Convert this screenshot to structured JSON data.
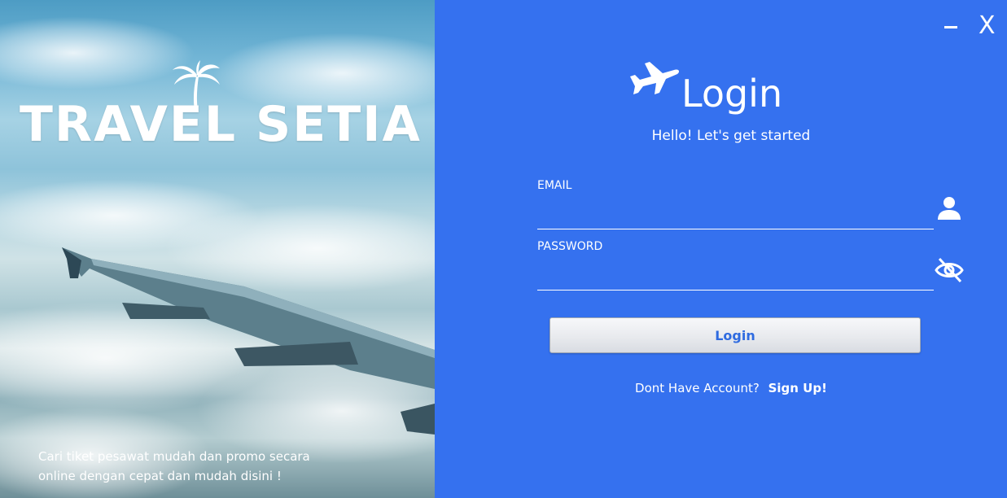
{
  "brand": {
    "title": "TRAVEL SETIA",
    "tagline_line1": "Cari tiket pesawat mudah dan  promo secara",
    "tagline_line2": "online dengan cepat dan mudah disini !"
  },
  "window": {
    "minimize_label": "",
    "close_label": "X"
  },
  "login": {
    "title": "Login",
    "subtitle": "Hello! Let's get started",
    "email_label": "EMAIL",
    "email_value": "",
    "password_label": "PASSWORD",
    "password_value": "",
    "button_label": "Login",
    "no_account_text": "Dont Have Account?",
    "signup_link": "Sign Up!"
  },
  "icons": {
    "brand_logo": "palm-tree-icon",
    "header_icon": "airplane-icon",
    "email_icon": "user-icon",
    "password_icon": "eye-off-icon"
  },
  "colors": {
    "panel_bg": "#3571ef",
    "button_text": "#2f6be0",
    "text": "#ffffff"
  }
}
